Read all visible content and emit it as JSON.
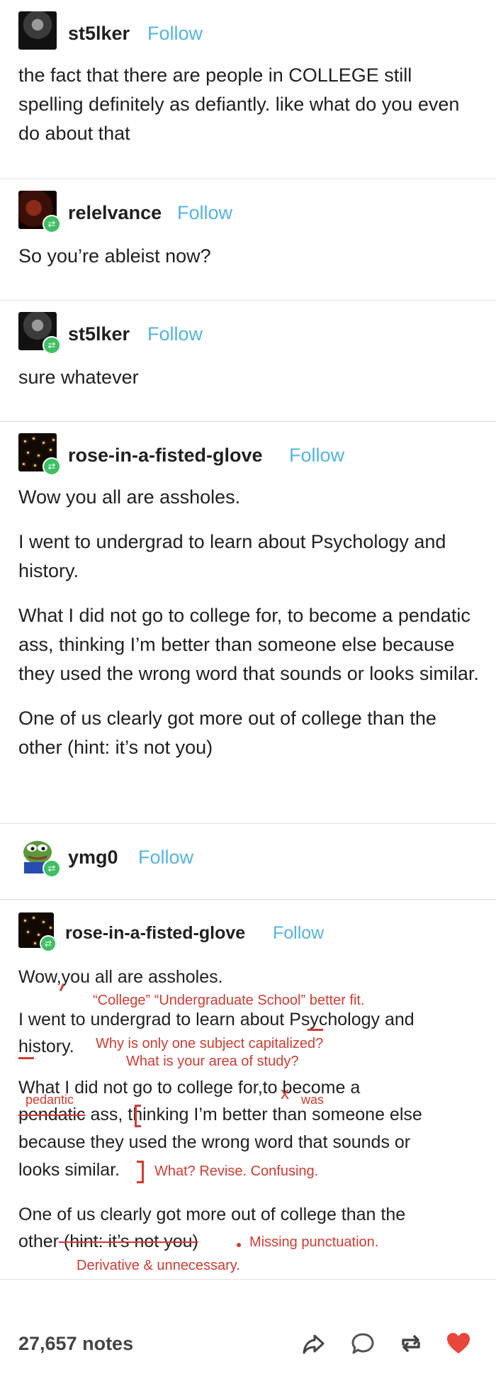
{
  "posts": [
    {
      "username": "st5lker",
      "follow": "Follow",
      "avatar": "dark-character-avatar",
      "paragraphs": [
        "the fact that there are people in COLLEGE still spelling definitely as defiantly. like what do you even do about that"
      ]
    },
    {
      "username": "relelvance",
      "follow": "Follow",
      "avatar": "dark-red-avatar",
      "paragraphs": [
        "So you’re ableist now?"
      ]
    },
    {
      "username": "st5lker",
      "follow": "Follow",
      "avatar": "dark-character-avatar",
      "paragraphs": [
        "sure whatever"
      ]
    },
    {
      "username": "rose-in-a-fisted-glove",
      "follow": "Follow",
      "avatar": "candles-avatar",
      "paragraphs": [
        "Wow you all are assholes.",
        "I went to undergrad to learn about Psychology and history.",
        "What I did not go to college for, to become a pendatic ass, thinking I’m better than someone else because they used the wrong word that sounds or looks similar.",
        "One of us clearly got more out of college than the other (hint: it’s not you)"
      ]
    },
    {
      "username": "ymg0",
      "follow": "Follow",
      "avatar": "pepe-frog-avatar"
    }
  ],
  "image_post": {
    "username": "rose-in-a-fisted-glove",
    "follow": "Follow",
    "lines": {
      "l1": "Wow,you all are assholes.",
      "l2": "I went to undergrad to learn about Psychology and",
      "l3": "history.",
      "l4": "What I did not go to college for,to become a",
      "l5_strike": "pendatic",
      "l5_rest": " ass, thinking I’m better than someone else",
      "l6": "because they used the wrong word that sounds or",
      "l7": "looks similar.",
      "l8": "One of us clearly got more out of college than the",
      "l9_a": "other",
      "l9_strike": " (hint: it’s not you)"
    },
    "annotations": {
      "college": "“College” “Undergraduate School” better fit.",
      "capitalized": "Why is only one subject capitalized?",
      "area": "What is your area of study?",
      "pedantic": "pedantic",
      "was": "was",
      "revise": "What? Revise. Confusing.",
      "punctuation": "Missing punctuation.",
      "derivative": "Derivative & unnecessary."
    }
  },
  "footer": {
    "notes": "27,657 notes",
    "actions": [
      "share-icon",
      "comment-icon",
      "reblog-icon",
      "heart-icon"
    ],
    "heart_color": "#e8483b"
  },
  "colors": {
    "follow": "#54b4e4",
    "annotation": "#d23b32",
    "reblog_badge": "#3fbf63"
  }
}
